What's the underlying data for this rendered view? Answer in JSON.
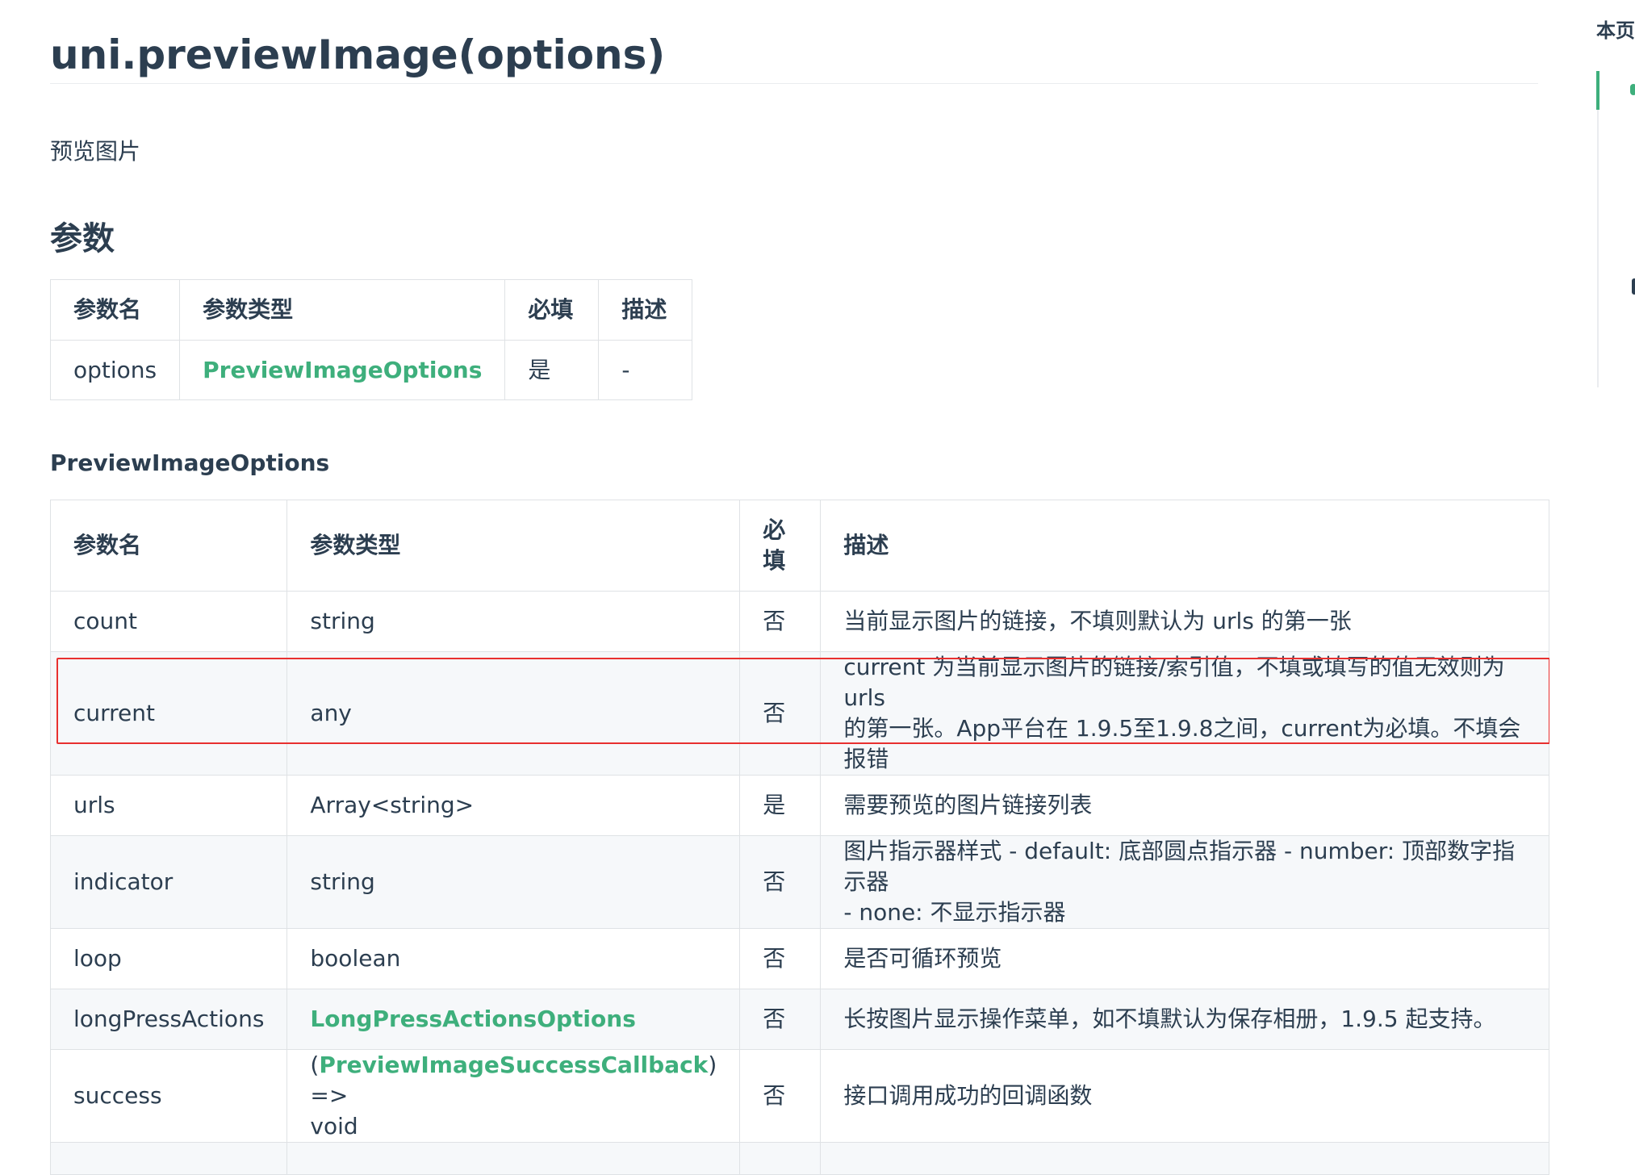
{
  "page": {
    "title": "uni.previewImage(options)",
    "description": "预览图片",
    "params_heading": "参数",
    "options_heading": "PreviewImageOptions"
  },
  "params_table": {
    "headers": [
      "参数名",
      "参数类型",
      "必填",
      "描述"
    ],
    "rows": [
      {
        "name": "options",
        "type": "PreviewImageOptions",
        "required": "是",
        "desc": "-"
      }
    ]
  },
  "options_table": {
    "headers": {
      "name": "参数名",
      "type": "参数类型",
      "required_1": "必",
      "required_2": "填",
      "desc": "描述"
    },
    "rows": [
      {
        "name": "count",
        "type": "string",
        "required": "否",
        "desc": "当前显示图片的链接，不填则默认为 urls 的第一张"
      },
      {
        "name": "current",
        "type": "any",
        "required": "否",
        "desc_1": "current 为当前显示图片的链接/索引值，不填或填写的值无效则为 urls",
        "desc_2": "的第一张。App平台在 1.9.5至1.9.8之间，current为必填。不填会报错"
      },
      {
        "name": "urls",
        "type": "Array<string>",
        "required": "是",
        "desc": "需要预览的图片链接列表"
      },
      {
        "name": "indicator",
        "type": "string",
        "required": "否",
        "desc_1": "图片指示器样式 - default: 底部圆点指示器 - number: 顶部数字指示器",
        "desc_2": "- none: 不显示指示器"
      },
      {
        "name": "loop",
        "type": "boolean",
        "required": "否",
        "desc": "是否可循环预览"
      },
      {
        "name": "longPressActions",
        "type": "LongPressActionsOptions",
        "required": "否",
        "desc": "长按图片显示操作菜单，如不填默认为保存相册，1.9.5 起支持。"
      },
      {
        "name": "success",
        "type_open": "(",
        "type_link": "PreviewImageSuccessCallback",
        "type_close": ") =>",
        "type_void": "void",
        "required": "否",
        "desc": "接口调用成功的回调函数"
      }
    ]
  },
  "sidebar": {
    "title": "本页"
  },
  "colors": {
    "accent": "#3eaf7c",
    "text": "#2c3e50",
    "border": "#dfe2e5",
    "row_alt": "#f6f8fa",
    "highlight_box": "#e8302f"
  }
}
